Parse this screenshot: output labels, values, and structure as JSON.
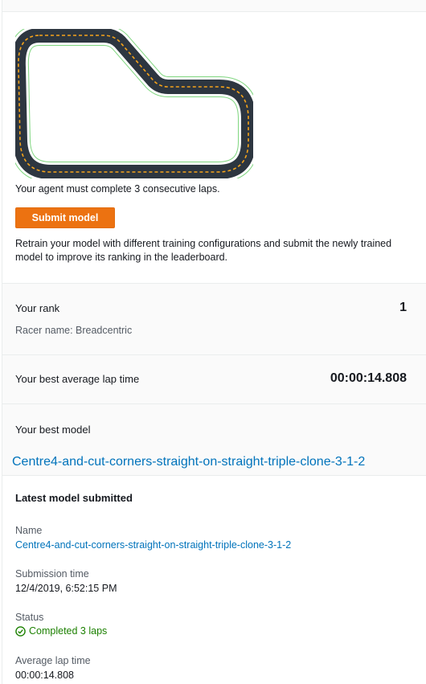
{
  "track": {
    "agent_note": "Your agent must complete 3 consecutive laps.",
    "submit_label": "Submit model",
    "retrain_text": "Retrain your model with different training configurations and submit the newly trained model to improve its ranking in the leaderboard."
  },
  "rank": {
    "label": "Your rank",
    "value": "1",
    "racer_name": "Racer name: Breadcentric"
  },
  "best_lap": {
    "label": "Your best average lap time",
    "value": "00:00:14.808"
  },
  "best_model": {
    "label": "Your best model",
    "name": "Centre4-and-cut-corners-straight-on-straight-triple-clone-3-1-2"
  },
  "latest": {
    "title": "Latest model submitted",
    "name_label": "Name",
    "name_value": "Centre4-and-cut-corners-straight-on-straight-triple-clone-3-1-2",
    "submission_label": "Submission time",
    "submission_value": "12/4/2019, 6:52:15 PM",
    "status_label": "Status",
    "status_value": "Completed 3 laps",
    "avg_label": "Average lap time",
    "avg_value": "00:00:14.808"
  },
  "colors": {
    "accent": "#ec7211",
    "link": "#0073bb",
    "success": "#1d8102",
    "track_surface": "#2d3640",
    "track_center_line": "#f5a31a",
    "track_border": "#7fd67f"
  },
  "icons": {
    "status": "check-circle-icon"
  }
}
